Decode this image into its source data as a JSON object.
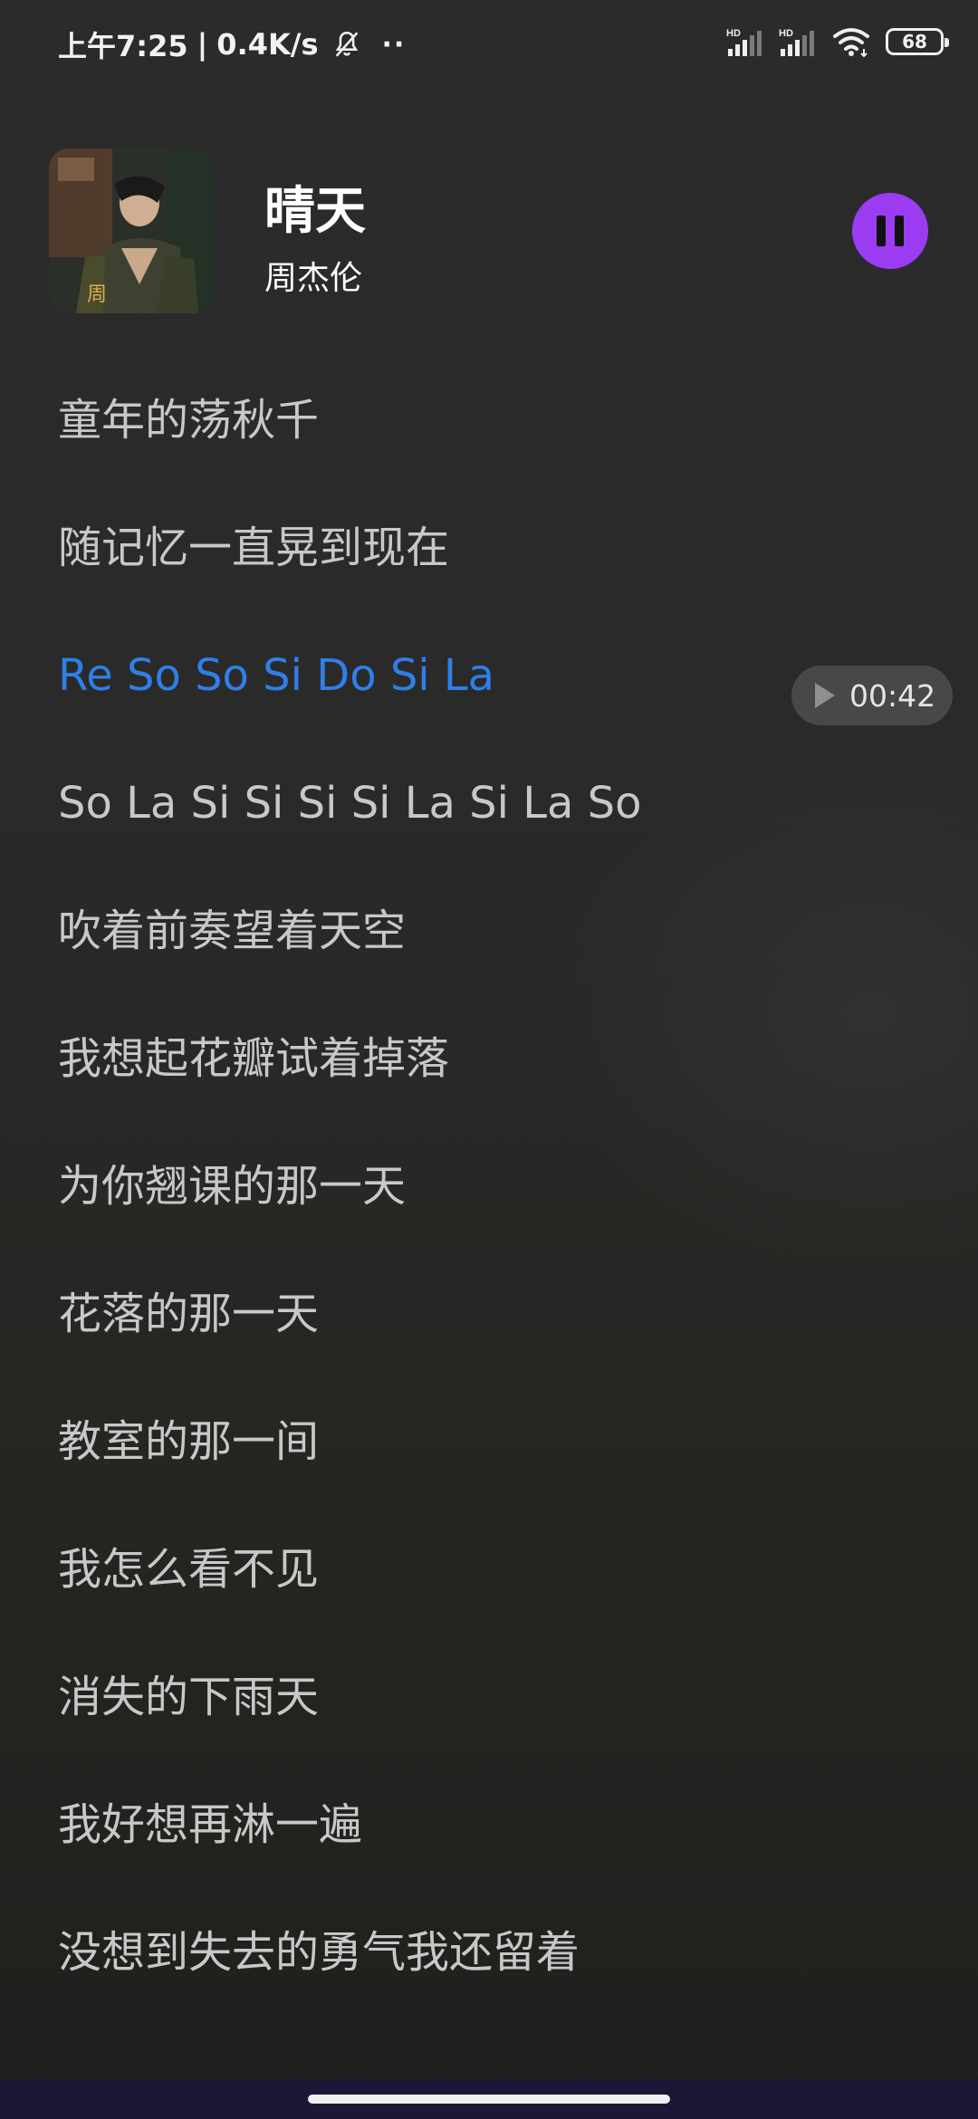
{
  "status_bar": {
    "time": "上午7:25",
    "net_speed": "0.4K/s",
    "more": "··",
    "signal1_label": "HD",
    "signal2_label": "HD",
    "battery": "68"
  },
  "song": {
    "title": "晴天",
    "artist": "周杰伦",
    "cover_icon": "album-cover"
  },
  "player": {
    "state_icon": "pause-icon",
    "accent_color": "#9b3cf2",
    "seek_time": "00:42"
  },
  "lyrics": [
    "童年的荡秋千",
    "随记忆一直晃到现在",
    "Re So So Si Do Si La",
    "So La Si Si Si Si La Si La So",
    "吹着前奏望着天空",
    "我想起花瓣试着掉落",
    "为你翘课的那一天",
    "花落的那一天",
    "教室的那一间",
    "我怎么看不见",
    "消失的下雨天",
    "我好想再淋一遍",
    "没想到失去的勇气我还留着"
  ],
  "active_lyric_color": "#2f7fe8"
}
